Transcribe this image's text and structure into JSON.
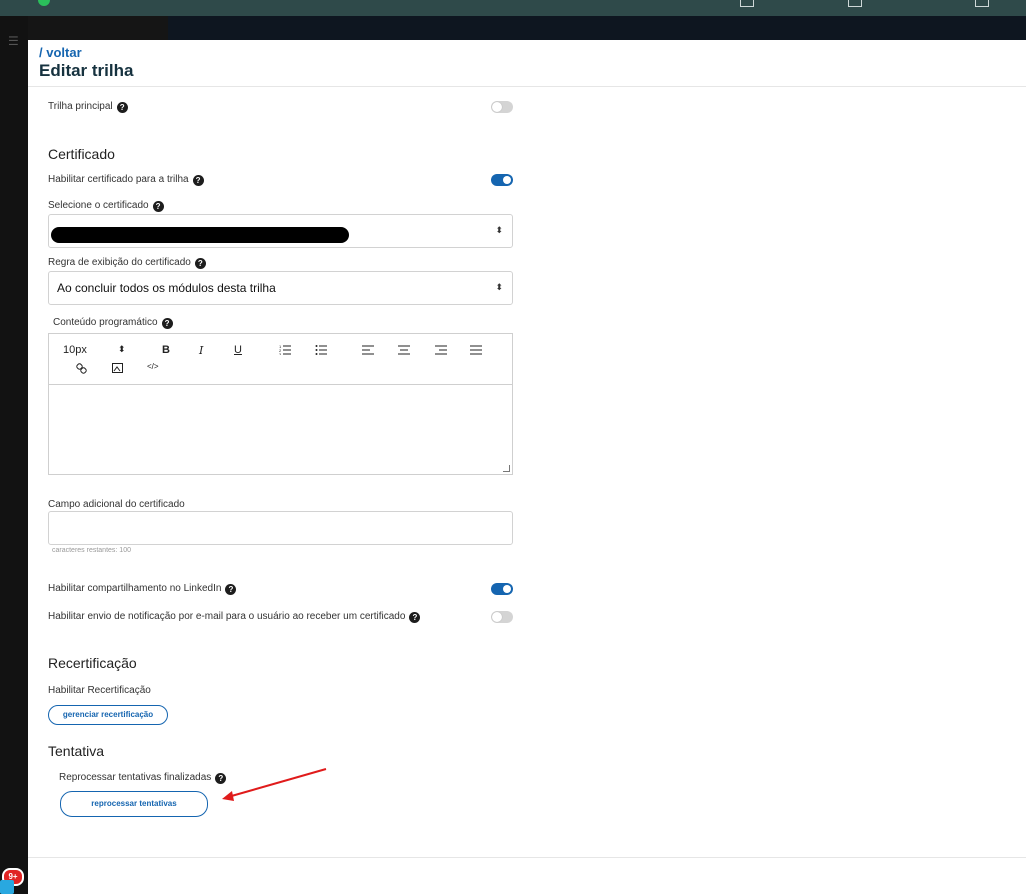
{
  "header": {
    "breadcrumb": "/ voltar",
    "title": "Editar trilha"
  },
  "fields": {
    "trilha_principal": {
      "label": "Trilha principal",
      "enabled": false
    }
  },
  "certificado": {
    "section_title": "Certificado",
    "habilitar": {
      "label": "Habilitar certificado para a trilha",
      "enabled": true
    },
    "selecione": {
      "label": "Selecione o certificado",
      "value": ""
    },
    "regra": {
      "label": "Regra de exibição do certificado",
      "value": "Ao concluir todos os módulos desta trilha"
    },
    "conteudo": {
      "label": "Conteúdo programático",
      "toolbar": {
        "font_size": "10px",
        "bold": "B",
        "italic": "I",
        "underline": "U",
        "code": "</>"
      }
    },
    "campo_adicional": {
      "label": "Campo adicional do certificado",
      "value": "",
      "hint": "caracteres restantes: 100"
    },
    "linkedin": {
      "label": "Habilitar compartilhamento no LinkedIn",
      "enabled": true
    },
    "email": {
      "label": "Habilitar envio de notificação por e-mail para o usuário ao receber um certificado",
      "enabled": false
    }
  },
  "recertificacao": {
    "section_title": "Recertificação",
    "label": "Habilitar Recertificação",
    "button": "gerenciar recertificação"
  },
  "tentativa": {
    "section_title": "Tentativa",
    "label": "Reprocessar tentativas finalizadas",
    "button": "reprocessar tentativas"
  },
  "notifications": {
    "badge": "9+"
  },
  "colors": {
    "accent": "#1565b0",
    "annotation_arrow": "#e01b1b",
    "topbar": "#2f4a4a"
  }
}
